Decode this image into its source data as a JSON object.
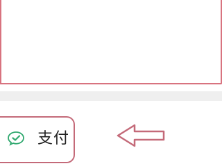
{
  "pay_option": {
    "label": "支付",
    "icon": "wechat-pay-icon",
    "icon_color": "#2fa86e"
  },
  "annotation": {
    "outline_color": "#c46a79",
    "arrow_icon": "left-arrow-annotation"
  }
}
